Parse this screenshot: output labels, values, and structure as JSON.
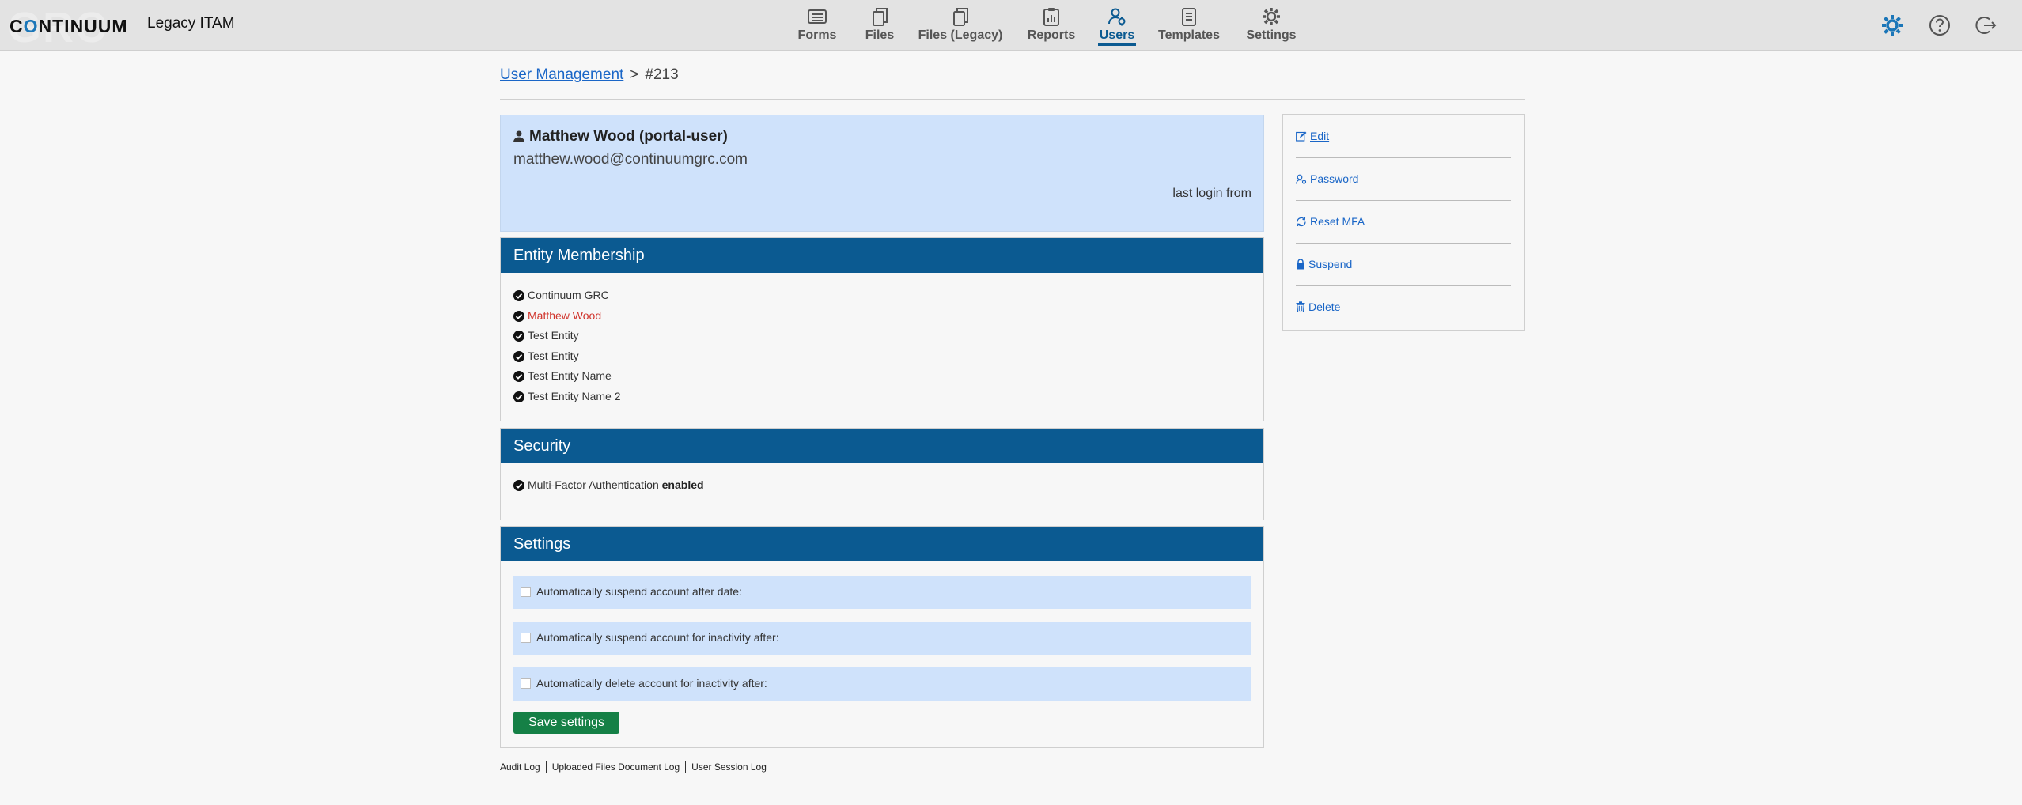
{
  "brand": {
    "watermark": "GRC",
    "logo_text_a": "C",
    "logo_text_o": "O",
    "logo_text_b": "NTINUUM",
    "app_name": "Legacy ITAM"
  },
  "nav": [
    {
      "label": "Forms",
      "icon": "forms-icon"
    },
    {
      "label": "Files",
      "icon": "files-icon"
    },
    {
      "label": "Files (Legacy)",
      "icon": "files-legacy-icon"
    },
    {
      "label": "Reports",
      "icon": "reports-icon"
    },
    {
      "label": "Users",
      "icon": "users-icon",
      "active": true
    },
    {
      "label": "Templates",
      "icon": "templates-icon"
    },
    {
      "label": "Settings",
      "icon": "settings-gear-icon"
    }
  ],
  "topbar_icons": [
    "admin-gear-icon",
    "help-icon",
    "logout-icon"
  ],
  "breadcrumb": {
    "link": "User Management",
    "separator": ">",
    "current": "#213"
  },
  "profile": {
    "name": "Matthew Wood (portal-user)",
    "email": "matthew.wood@continuumgrc.com",
    "last_login": "last login from"
  },
  "entity_membership": {
    "title": "Entity Membership",
    "items": [
      {
        "label": "Continuum GRC",
        "highlight": false
      },
      {
        "label": "Matthew Wood",
        "highlight": true
      },
      {
        "label": "Test Entity",
        "highlight": false
      },
      {
        "label": "Test Entity",
        "highlight": false
      },
      {
        "label": "Test Entity Name",
        "highlight": false
      },
      {
        "label": "Test Entity Name 2",
        "highlight": false
      }
    ]
  },
  "security": {
    "title": "Security",
    "mfa_label": "Multi-Factor Authentication",
    "mfa_status": "enabled"
  },
  "settings": {
    "title": "Settings",
    "options": [
      {
        "label": "Automatically suspend account after date:",
        "checked": false
      },
      {
        "label": "Automatically suspend account for inactivity after:",
        "checked": false
      },
      {
        "label": "Automatically delete account for inactivity after:",
        "checked": false
      }
    ],
    "save_label": "Save settings"
  },
  "footer_links": [
    "Audit Log",
    "Uploaded Files Document Log",
    "User Session Log"
  ],
  "actions": [
    {
      "label": "Edit",
      "icon": "edit-icon"
    },
    {
      "label": "Password",
      "icon": "password-user-icon"
    },
    {
      "label": "Reset MFA",
      "icon": "reset-icon"
    },
    {
      "label": "Suspend",
      "icon": "lock-icon"
    },
    {
      "label": "Delete",
      "icon": "trash-icon"
    }
  ],
  "colors": {
    "header_blue": "#0b5a91",
    "link_blue": "#1a66c7",
    "panel_light_blue": "#cfe2fb",
    "save_green": "#158046",
    "highlight_red": "#d0342c"
  }
}
